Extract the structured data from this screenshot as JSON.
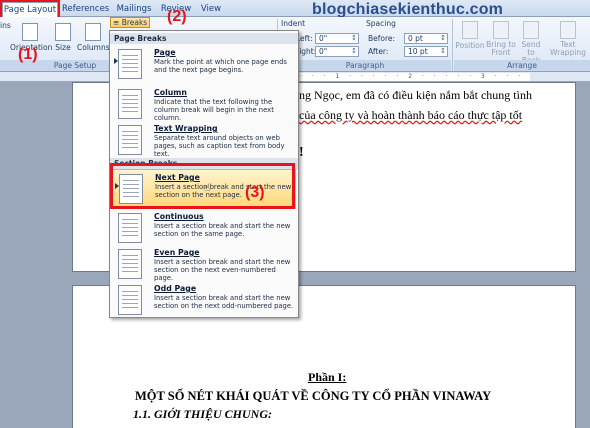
{
  "watermark": "blogchiasekienthuc.com",
  "tabs": [
    "Page Layout",
    "References",
    "Mailings",
    "Review",
    "View"
  ],
  "ribbon": {
    "margins": "ins",
    "orientation": "Orientation",
    "size": "Size",
    "columns": "Columns",
    "breaks": "Breaks",
    "page_setup": "Page Setup",
    "indent": "Indent",
    "left_label": "Left:",
    "left_value": "0\"",
    "right_label": "Right:",
    "right_value": "0\"",
    "spacing": "Spacing",
    "before_label": "Before:",
    "before_value": "0 pt",
    "after_label": "After:",
    "after_value": "10 pt",
    "paragraph": "Paragraph",
    "position": "Position",
    "bring_to_front": "Bring to Front",
    "send_to_back": "Send to Back",
    "text_wrapping": "Text Wrapping",
    "arrange": "Arrange"
  },
  "annotations": [
    "(1)",
    "(2)",
    "(3)"
  ],
  "menu": {
    "page_breaks_header": "Page Breaks",
    "section_breaks_header": "Section Breaks",
    "items": [
      {
        "title": "Page",
        "desc": "Mark the point at which one page ends and the next page begins."
      },
      {
        "title": "Column",
        "desc": "Indicate that the text following the column break will begin in the next column."
      },
      {
        "title": "Text Wrapping",
        "desc": "Separate text around objects on web pages, such as caption text from body text."
      },
      {
        "title": "Next Page",
        "desc": "Insert a section break and start the new section on the next page."
      },
      {
        "title": "Continuous",
        "desc": "Insert a section break and start the new section on the same page."
      },
      {
        "title": "Even Page",
        "desc": "Insert a section break and start the new section on the next even-numbered page."
      },
      {
        "title": "Odd Page",
        "desc": "Insert a section break and start the new section on the next odd-numbered page."
      }
    ]
  },
  "document": {
    "line1": "ng Ngọc, em đã có điều kiện nắm bắt chung tình",
    "line2": "của công ty và hoàn thành báo cáo thực tập tốt",
    "line3": "!",
    "heading_part": "Phần I:",
    "heading_title": "MỘT SỐ NÉT KHÁI QUÁT VỀ CÔNG TY CỔ PHẦN VINAWAY",
    "subheading": "1.1. GIỚI THIỆU CHUNG:"
  }
}
